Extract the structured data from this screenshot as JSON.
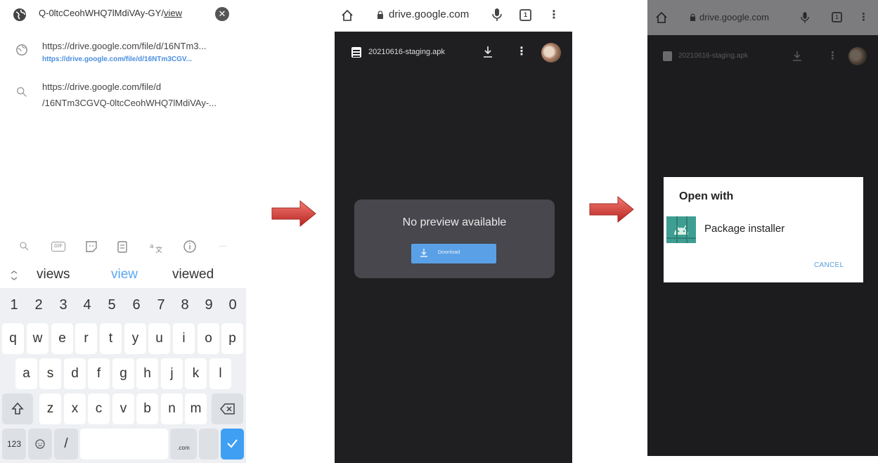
{
  "panel1": {
    "url_bar": {
      "text": "Q-0ltcCeohWHQ7lMdiVAy-GY/",
      "text_underlined": "view",
      "clear_icon": "clear-circle-icon"
    },
    "suggestions": [
      {
        "icon": "globe-icon",
        "line1": "https://drive.google.com/file/d/16NTm3...",
        "line2": "https://drive.google.com/file/d/16NTm3CGV..."
      },
      {
        "icon": "search-icon",
        "line1": "https://drive.google.com/file/d",
        "line2": "/16NTm3CGVQ-0ltcCeohWHQ7lMdiVAy-..."
      }
    ],
    "toolbar_icons": [
      "search-icon",
      "gif-icon",
      "sticker-icon",
      "clipboard-icon",
      "translate-icon",
      "info-icon",
      "more-icon"
    ],
    "gif_label": "GIF",
    "more_label": "···",
    "predictions": {
      "collapse_icon": "chevron-collapse-icon",
      "left": "views",
      "center": "view",
      "right": "viewed"
    },
    "keyboard": {
      "row_numbers": [
        "1",
        "2",
        "3",
        "4",
        "5",
        "6",
        "7",
        "8",
        "9",
        "0"
      ],
      "row1": [
        "q",
        "w",
        "e",
        "r",
        "t",
        "y",
        "u",
        "i",
        "o",
        "p"
      ],
      "row2": [
        "a",
        "s",
        "d",
        "f",
        "g",
        "h",
        "j",
        "k",
        "l"
      ],
      "row3": [
        "z",
        "x",
        "c",
        "v",
        "b",
        "n",
        "m"
      ],
      "shift_icon": "shift-icon",
      "backspace_icon": "backspace-icon",
      "key_123": "123",
      "emoji_icon": "emoji-icon",
      "slash": "/",
      "com": ".com",
      "enter_icon": "checkmark-icon"
    }
  },
  "panel2": {
    "domain": "drive.google.com",
    "tab_count": "1",
    "file_name": "20210616-staging.apk",
    "preview_message": "No preview available",
    "download_label": "Download"
  },
  "panel3": {
    "domain": "drive.google.com",
    "tab_count": "1",
    "file_name": "20210616-staging.apk",
    "dialog_title": "Open with",
    "app_name": "Package installer",
    "cancel_label": "CANCEL"
  },
  "colors": {
    "accent_blue": "#4a8fe0",
    "enter_key": "#3f9ff3",
    "arrow_red": "#d9403a",
    "drive_dark": "#1f1f21",
    "installer_teal": "#3e9e92"
  }
}
